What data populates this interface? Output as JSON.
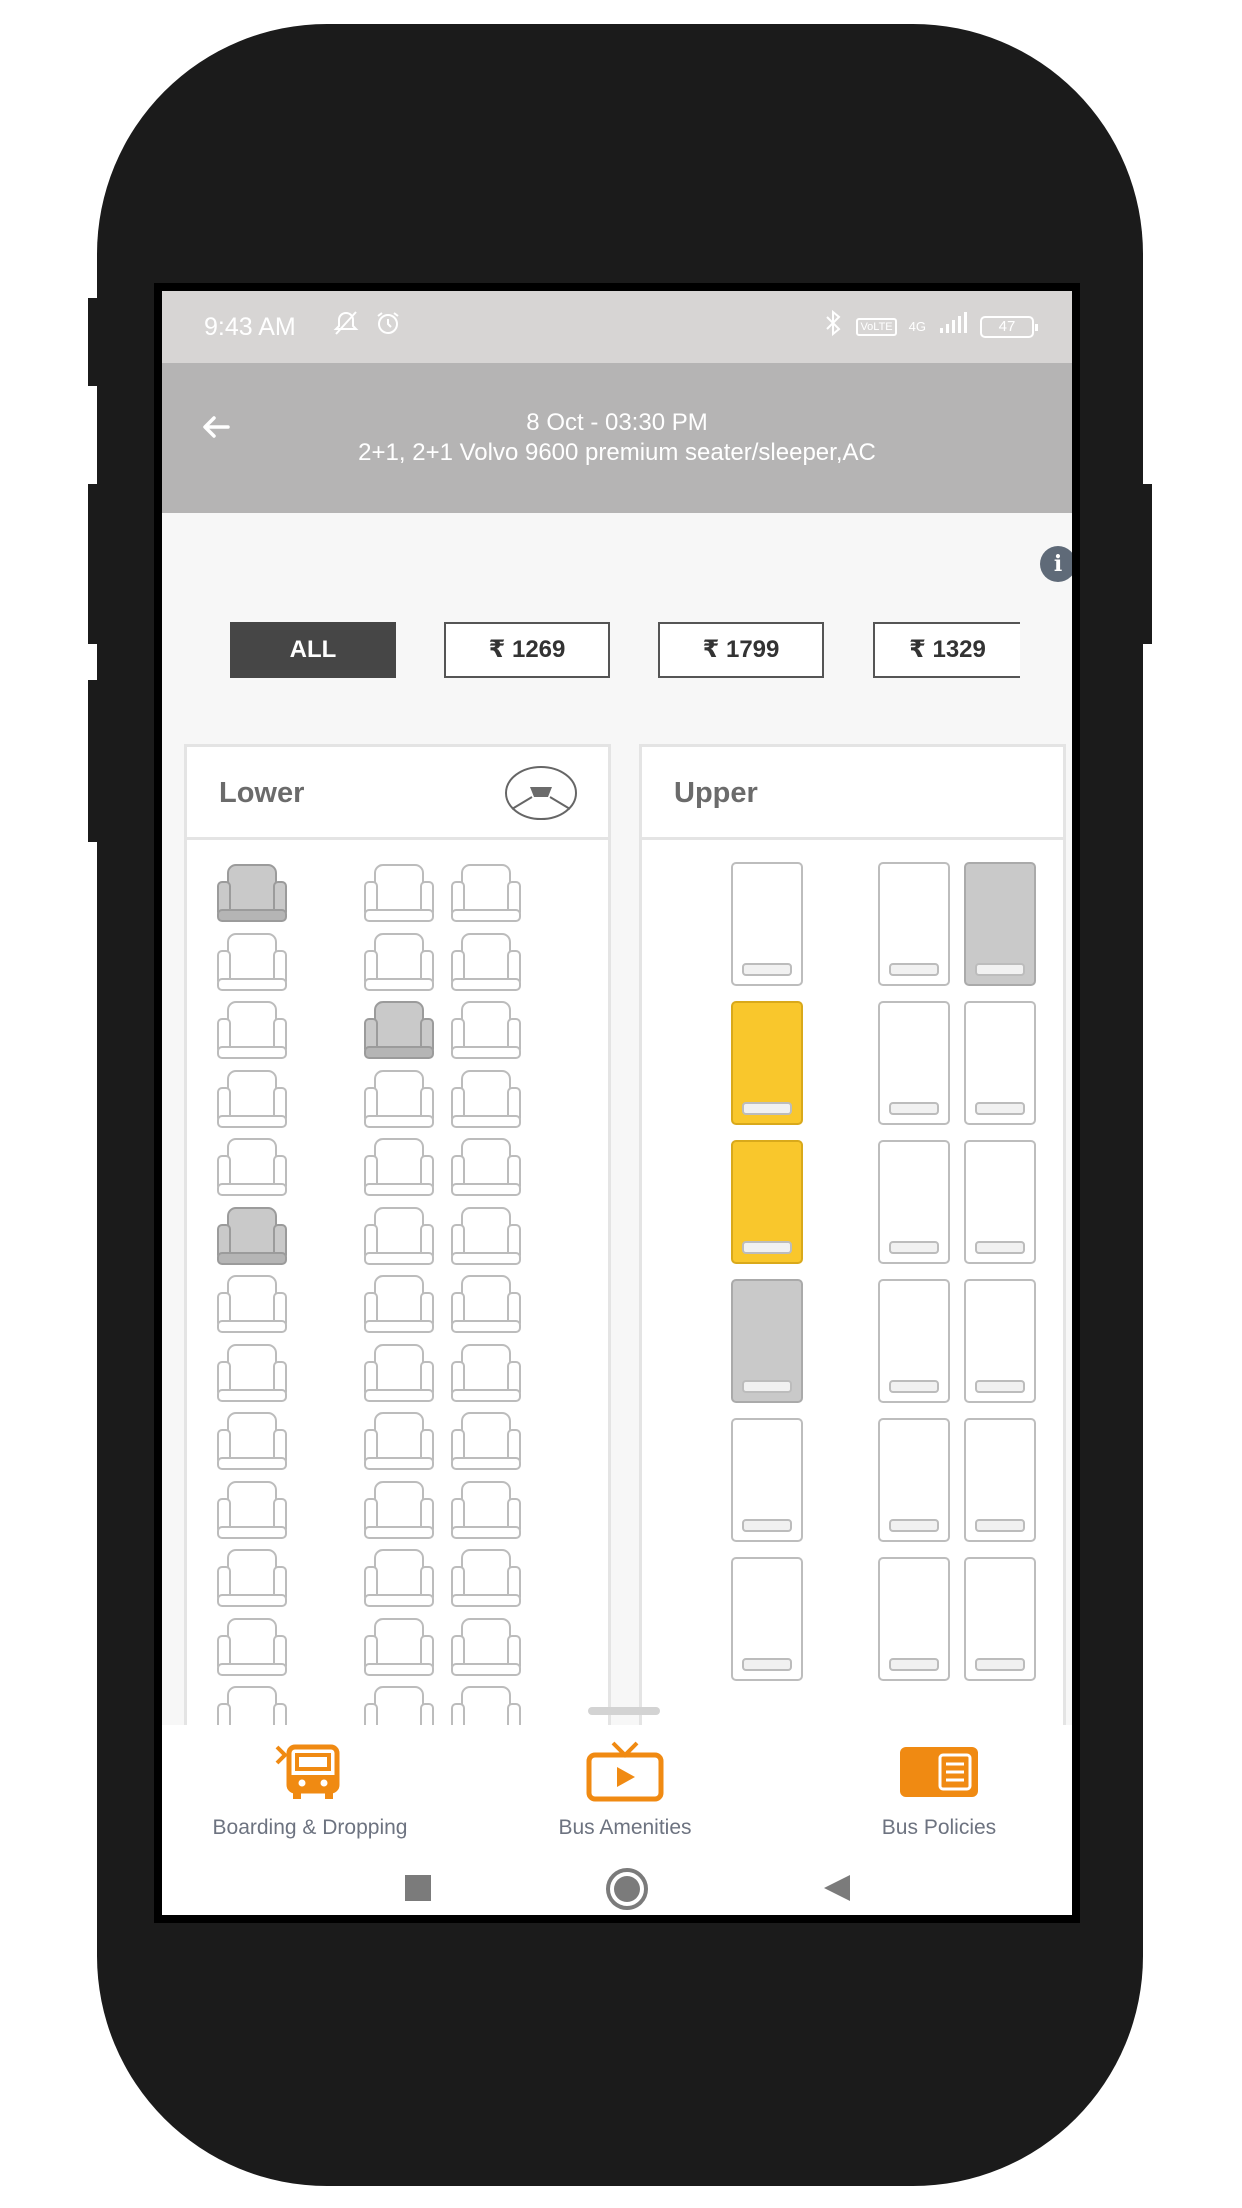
{
  "status_bar": {
    "time": "9:43 AM",
    "network": "4G",
    "battery": "47",
    "volte": "VoLTE"
  },
  "header": {
    "line1": "8 Oct - 03:30 PM",
    "line2": "2+1, 2+1 Volvo 9600 premium seater/sleeper,AC"
  },
  "filters": [
    "ALL",
    "₹ 1269",
    "₹ 1799",
    "₹ 1329"
  ],
  "decks": {
    "lower_title": "Lower",
    "upper_title": "Upper"
  },
  "lower_seats": {
    "rows": 12,
    "columns": 3,
    "booked": [
      [
        0,
        0
      ],
      [
        2,
        1
      ],
      [
        5,
        0
      ]
    ]
  },
  "upper_berths": {
    "rows": 6,
    "columns": 3,
    "status": [
      [
        "available",
        "available",
        "booked"
      ],
      [
        "selected",
        "available",
        "available"
      ],
      [
        "selected",
        "available",
        "available"
      ],
      [
        "booked",
        "available",
        "available"
      ],
      [
        "available",
        "available",
        "available"
      ],
      [
        "available",
        "available",
        "available"
      ]
    ]
  },
  "bottom_tabs": {
    "boarding": "Boarding & Dropping",
    "amenities": "Bus Amenities",
    "policies": "Bus Policies"
  },
  "colors": {
    "accent": "#f08a12",
    "selected": "#f9c72c",
    "booked": "#c9c9c9"
  }
}
